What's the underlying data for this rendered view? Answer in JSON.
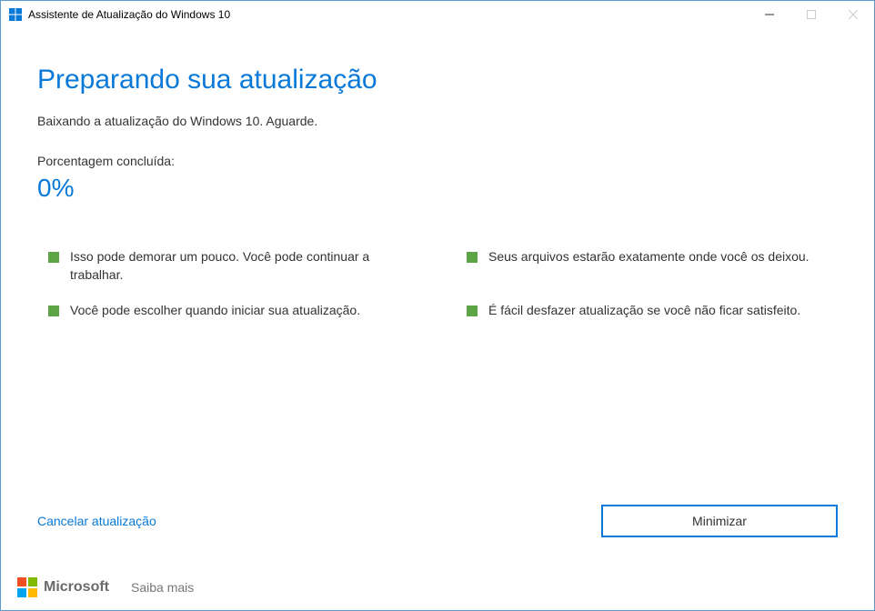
{
  "window": {
    "title": "Assistente de Atualização do Windows 10"
  },
  "page": {
    "title": "Preparando sua atualização",
    "status_text": "Baixando a atualização do Windows 10. Aguarde.",
    "percent_label": "Porcentagem concluída:",
    "percent_value": "0%"
  },
  "info_items": [
    "Isso pode demorar um pouco. Você pode continuar a trabalhar.",
    "Seus arquivos estarão exatamente onde você os deixou.",
    "Você pode escolher quando iniciar sua atualização.",
    "É fácil desfazer atualização se você não ficar satisfeito."
  ],
  "actions": {
    "cancel": "Cancelar atualização",
    "minimize": "Minimizar"
  },
  "footer": {
    "brand": "Microsoft",
    "learn_more": "Saiba mais"
  },
  "colors": {
    "accent": "#0879d8",
    "bullet": "#5da444"
  }
}
